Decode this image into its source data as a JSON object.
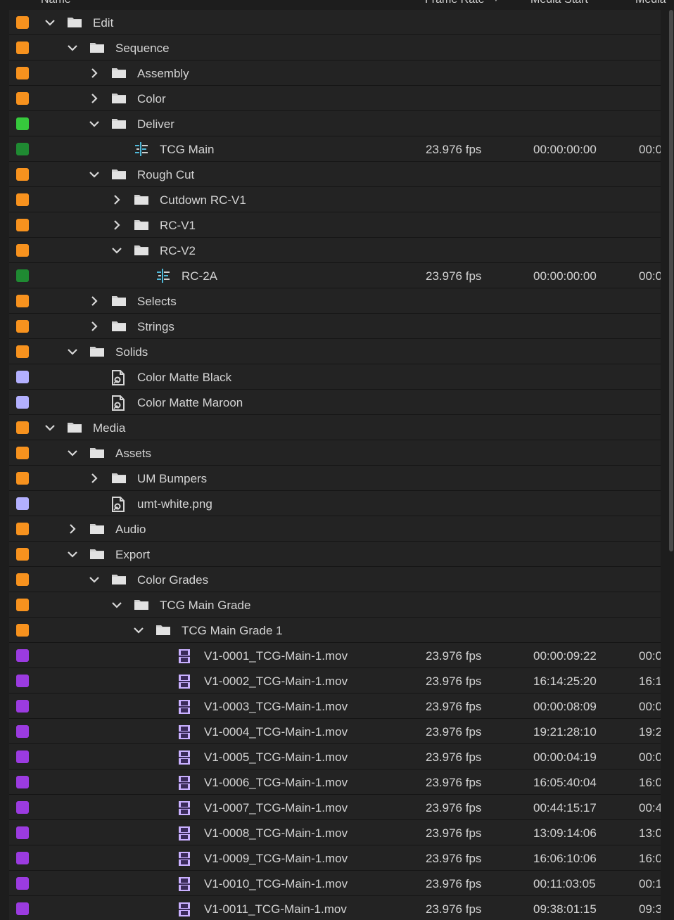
{
  "header": {
    "name": "Name",
    "frame_rate": "Frame Rate",
    "media_start": "Media Start",
    "media_end_cut": "Media"
  },
  "colors": {
    "orange": "#f7921e",
    "green_bright": "#36c93c",
    "green_dark": "#1f8a32",
    "lavender": "#b3b0ff",
    "purple": "#9b3be0"
  },
  "rows": [
    {
      "label": "Edit",
      "depth": 0,
      "twisty": "open",
      "icon": "folder-icon",
      "color": "orange"
    },
    {
      "label": "Sequence",
      "depth": 1,
      "twisty": "open",
      "icon": "folder-icon",
      "color": "orange"
    },
    {
      "label": "Assembly",
      "depth": 2,
      "twisty": "closed",
      "icon": "folder-icon",
      "color": "orange"
    },
    {
      "label": "Color",
      "depth": 2,
      "twisty": "closed",
      "icon": "folder-icon",
      "color": "orange"
    },
    {
      "label": "Deliver",
      "depth": 2,
      "twisty": "open",
      "icon": "folder-icon",
      "color": "green_bright"
    },
    {
      "label": "TCG Main",
      "depth": 3,
      "twisty": "none",
      "icon": "sequence-icon",
      "color": "green_dark",
      "fps": "23.976 fps",
      "start": "00:00:00:00",
      "end": "00:0"
    },
    {
      "label": "Rough Cut",
      "depth": 2,
      "twisty": "open",
      "icon": "folder-icon",
      "color": "orange"
    },
    {
      "label": "Cutdown RC-V1",
      "depth": 3,
      "twisty": "closed",
      "icon": "folder-icon",
      "color": "orange"
    },
    {
      "label": "RC-V1",
      "depth": 3,
      "twisty": "closed",
      "icon": "folder-icon",
      "color": "orange"
    },
    {
      "label": "RC-V2",
      "depth": 3,
      "twisty": "open",
      "icon": "folder-icon",
      "color": "orange"
    },
    {
      "label": "RC-2A",
      "depth": 4,
      "twisty": "none",
      "icon": "sequence-icon",
      "color": "green_dark",
      "fps": "23.976 fps",
      "start": "00:00:00:00",
      "end": "00:0"
    },
    {
      "label": "Selects",
      "depth": 2,
      "twisty": "closed",
      "icon": "folder-icon",
      "color": "orange"
    },
    {
      "label": "Strings",
      "depth": 2,
      "twisty": "closed",
      "icon": "folder-icon",
      "color": "orange"
    },
    {
      "label": "Solids",
      "depth": 1,
      "twisty": "open",
      "icon": "folder-icon",
      "color": "orange"
    },
    {
      "label": "Color Matte Black",
      "depth": 2,
      "twisty": "none",
      "icon": "still-image-icon",
      "color": "lavender"
    },
    {
      "label": "Color Matte Maroon",
      "depth": 2,
      "twisty": "none",
      "icon": "still-image-icon",
      "color": "lavender"
    },
    {
      "label": "Media",
      "depth": 0,
      "twisty": "open",
      "icon": "folder-icon",
      "color": "orange"
    },
    {
      "label": "Assets",
      "depth": 1,
      "twisty": "open",
      "icon": "folder-icon",
      "color": "orange"
    },
    {
      "label": "UM Bumpers",
      "depth": 2,
      "twisty": "closed",
      "icon": "folder-icon",
      "color": "orange"
    },
    {
      "label": "umt-white.png",
      "depth": 2,
      "twisty": "none",
      "icon": "still-image-icon",
      "color": "lavender"
    },
    {
      "label": "Audio",
      "depth": 1,
      "twisty": "closed",
      "icon": "folder-icon",
      "color": "orange"
    },
    {
      "label": "Export",
      "depth": 1,
      "twisty": "open",
      "icon": "folder-icon",
      "color": "orange"
    },
    {
      "label": "Color Grades",
      "depth": 2,
      "twisty": "open",
      "icon": "folder-icon",
      "color": "orange"
    },
    {
      "label": "TCG Main Grade",
      "depth": 3,
      "twisty": "open",
      "icon": "folder-icon",
      "color": "orange"
    },
    {
      "label": "TCG Main Grade 1",
      "depth": 4,
      "twisty": "open",
      "icon": "folder-icon",
      "color": "orange"
    },
    {
      "label": "V1-0001_TCG-Main-1.mov",
      "depth": 5,
      "twisty": "none",
      "icon": "film-clip-icon",
      "color": "purple",
      "fps": "23.976 fps",
      "start": "00:00:09:22",
      "end": "00:0"
    },
    {
      "label": "V1-0002_TCG-Main-1.mov",
      "depth": 5,
      "twisty": "none",
      "icon": "film-clip-icon",
      "color": "purple",
      "fps": "23.976 fps",
      "start": "16:14:25:20",
      "end": "16:1"
    },
    {
      "label": "V1-0003_TCG-Main-1.mov",
      "depth": 5,
      "twisty": "none",
      "icon": "film-clip-icon",
      "color": "purple",
      "fps": "23.976 fps",
      "start": "00:00:08:09",
      "end": "00:0"
    },
    {
      "label": "V1-0004_TCG-Main-1.mov",
      "depth": 5,
      "twisty": "none",
      "icon": "film-clip-icon",
      "color": "purple",
      "fps": "23.976 fps",
      "start": "19:21:28:10",
      "end": "19:2"
    },
    {
      "label": "V1-0005_TCG-Main-1.mov",
      "depth": 5,
      "twisty": "none",
      "icon": "film-clip-icon",
      "color": "purple",
      "fps": "23.976 fps",
      "start": "00:00:04:19",
      "end": "00:0"
    },
    {
      "label": "V1-0006_TCG-Main-1.mov",
      "depth": 5,
      "twisty": "none",
      "icon": "film-clip-icon",
      "color": "purple",
      "fps": "23.976 fps",
      "start": "16:05:40:04",
      "end": "16:0"
    },
    {
      "label": "V1-0007_TCG-Main-1.mov",
      "depth": 5,
      "twisty": "none",
      "icon": "film-clip-icon",
      "color": "purple",
      "fps": "23.976 fps",
      "start": "00:44:15:17",
      "end": "00:4"
    },
    {
      "label": "V1-0008_TCG-Main-1.mov",
      "depth": 5,
      "twisty": "none",
      "icon": "film-clip-icon",
      "color": "purple",
      "fps": "23.976 fps",
      "start": "13:09:14:06",
      "end": "13:0"
    },
    {
      "label": "V1-0009_TCG-Main-1.mov",
      "depth": 5,
      "twisty": "none",
      "icon": "film-clip-icon",
      "color": "purple",
      "fps": "23.976 fps",
      "start": "16:06:10:06",
      "end": "16:0"
    },
    {
      "label": "V1-0010_TCG-Main-1.mov",
      "depth": 5,
      "twisty": "none",
      "icon": "film-clip-icon",
      "color": "purple",
      "fps": "23.976 fps",
      "start": "00:11:03:05",
      "end": "00:1"
    },
    {
      "label": "V1-0011_TCG-Main-1.mov",
      "depth": 5,
      "twisty": "none",
      "icon": "film-clip-icon",
      "color": "purple",
      "fps": "23.976 fps",
      "start": "09:38:01:15",
      "end": "09:3"
    }
  ]
}
